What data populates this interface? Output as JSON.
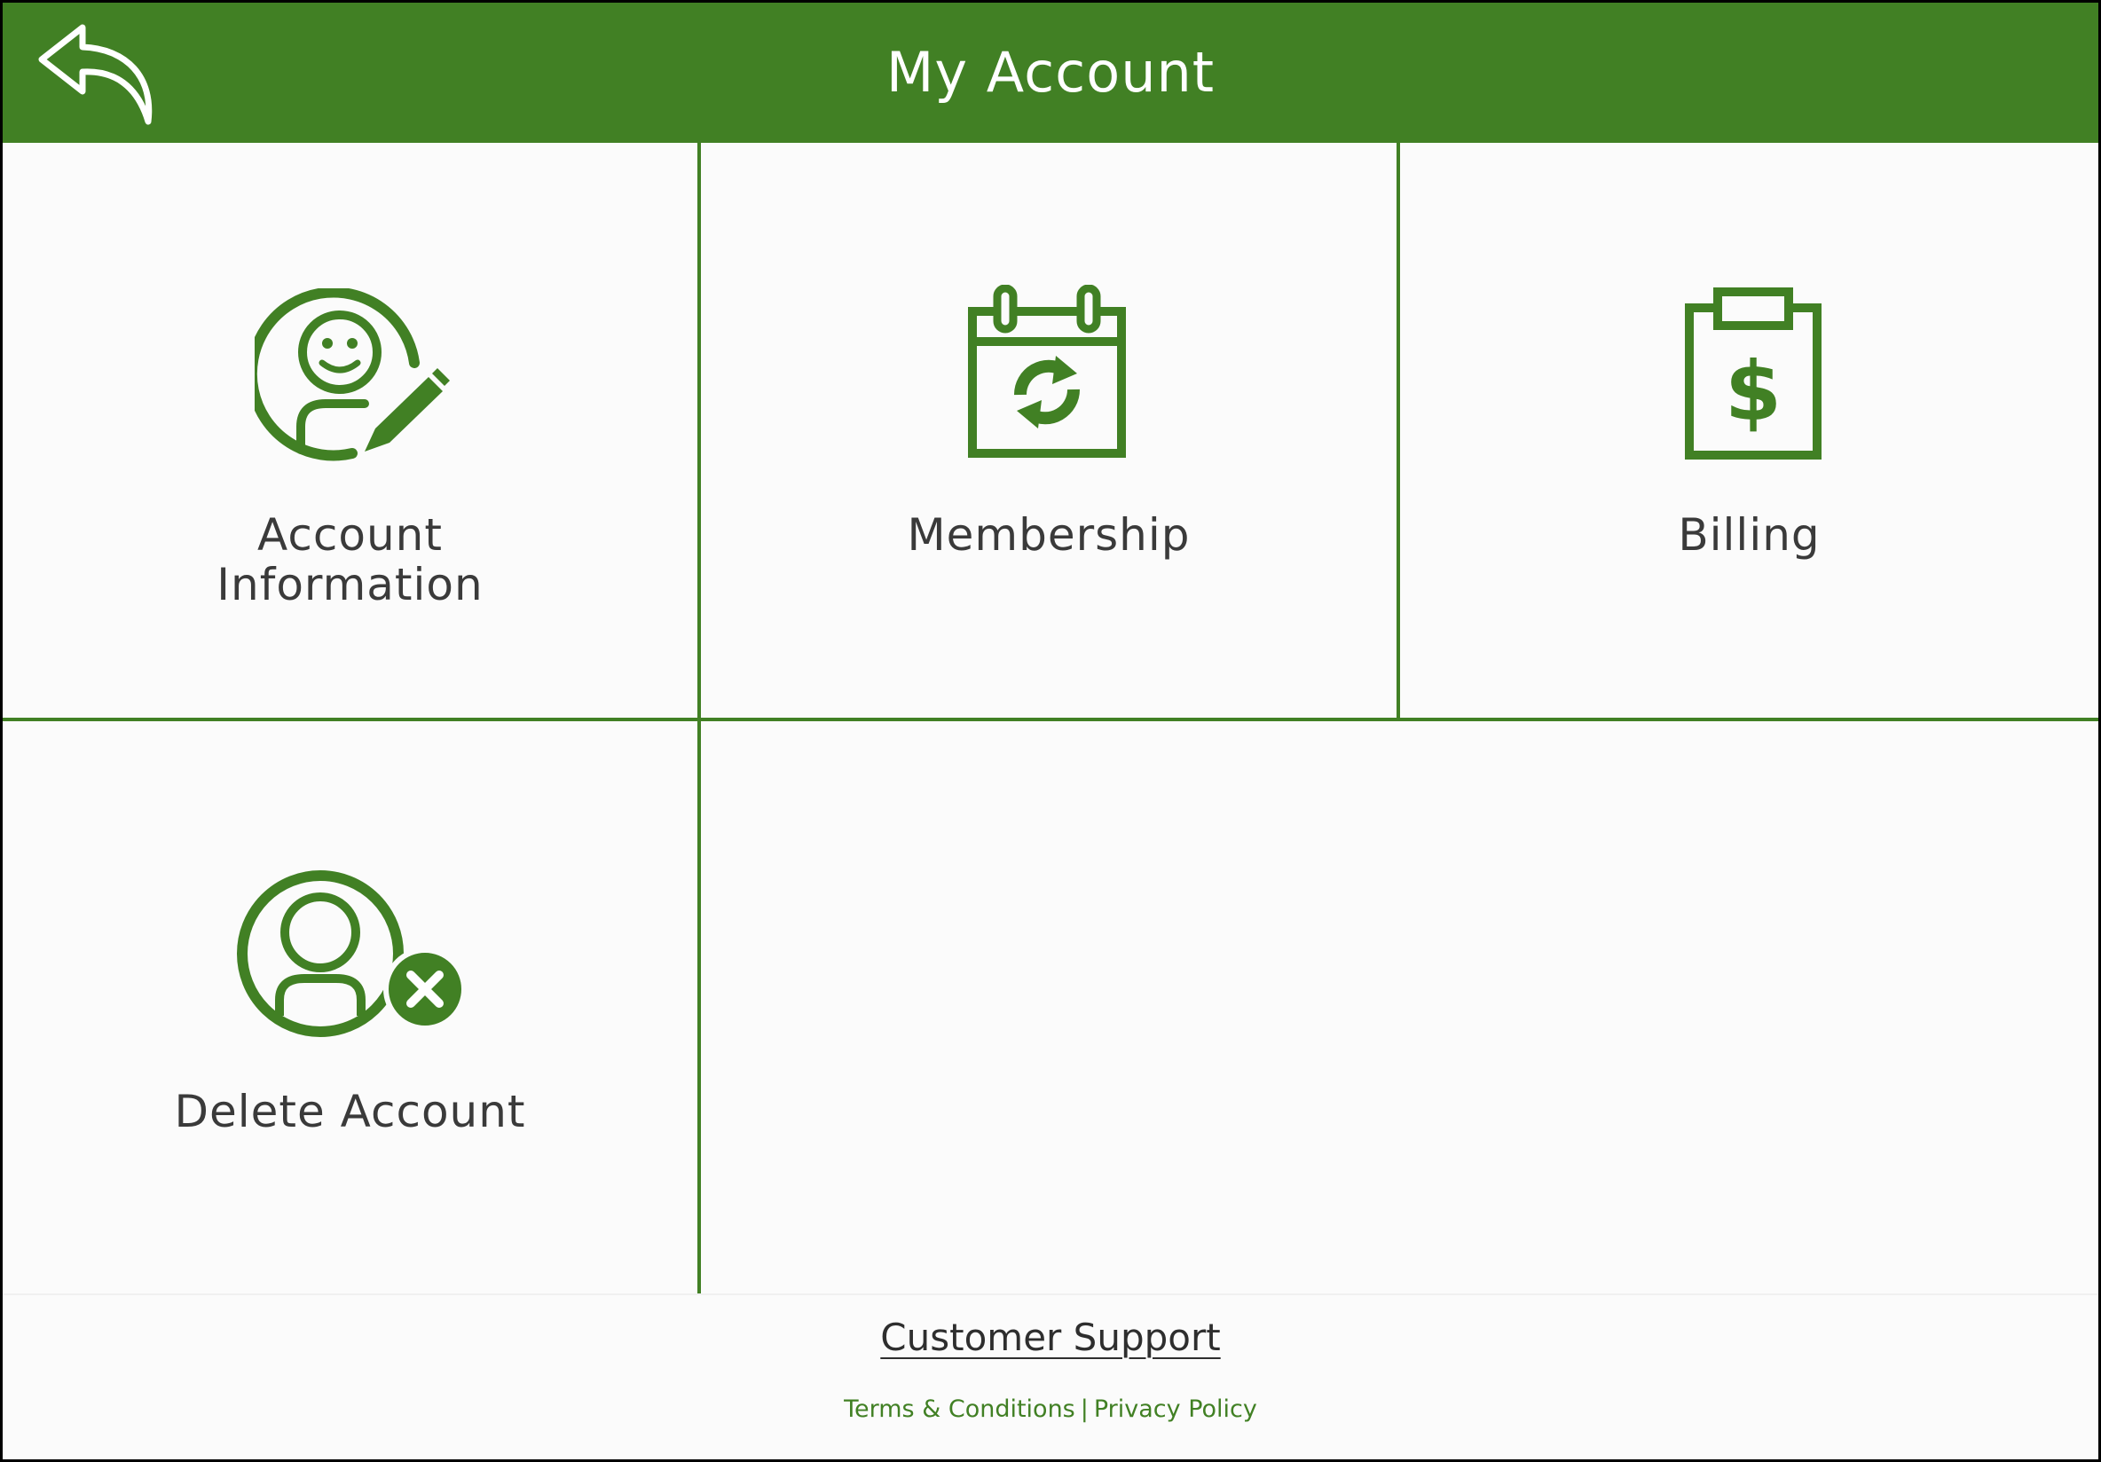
{
  "header": {
    "title": "My Account",
    "back_icon": "reply-arrow-icon"
  },
  "tiles": [
    {
      "label_line1": "Account",
      "label_line2": "Information",
      "icon": "user-edit-icon"
    },
    {
      "label": "Membership",
      "icon": "calendar-refresh-icon"
    },
    {
      "label": "Billing",
      "icon": "clipboard-dollar-icon"
    },
    {
      "label": "Delete Account",
      "icon": "user-remove-icon"
    }
  ],
  "footer": {
    "support_link": "Customer Support",
    "terms_link": "Terms & Conditions",
    "divider": "|",
    "privacy_link": "Privacy Policy"
  },
  "colors": {
    "brand_green": "#418024",
    "background": "#fbfbfb",
    "text": "#3a3a3a"
  }
}
